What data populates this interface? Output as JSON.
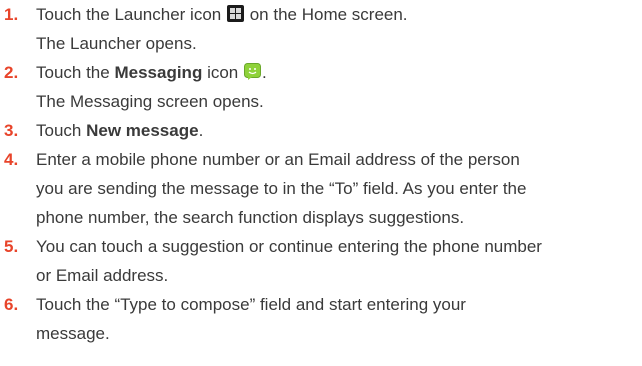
{
  "steps": [
    {
      "num": "1.",
      "pre": "Touch the Launcher icon",
      "icon": "launcher-grid-icon",
      "post": "on the Home screen.",
      "result": "The Launcher opens."
    },
    {
      "num": "2.",
      "pre": "Touch the",
      "bold": "Messaging",
      "mid": "icon",
      "icon": "messaging-smiley-icon",
      "post": ".",
      "result": "The Messaging screen opens."
    },
    {
      "num": "3.",
      "pre": "Touch",
      "bold": "New message",
      "post": "."
    },
    {
      "num": "4.",
      "lines": [
        "Enter a mobile phone number or an Email address of the person",
        "you are sending the message to in the “To” field. As you enter the",
        "phone number, the search function displays suggestions."
      ]
    },
    {
      "num": "5.",
      "lines": [
        "You can touch a suggestion or continue entering the phone number",
        "or Email address."
      ]
    },
    {
      "num": "6.",
      "lines": [
        "Touch the “Type to compose” field and start entering your",
        "message."
      ]
    }
  ],
  "colors": {
    "step_number": "#e8442a",
    "text": "#3a3a3a",
    "messaging_icon": "#8fd23a",
    "launcher_icon": "#1b1b1b"
  }
}
